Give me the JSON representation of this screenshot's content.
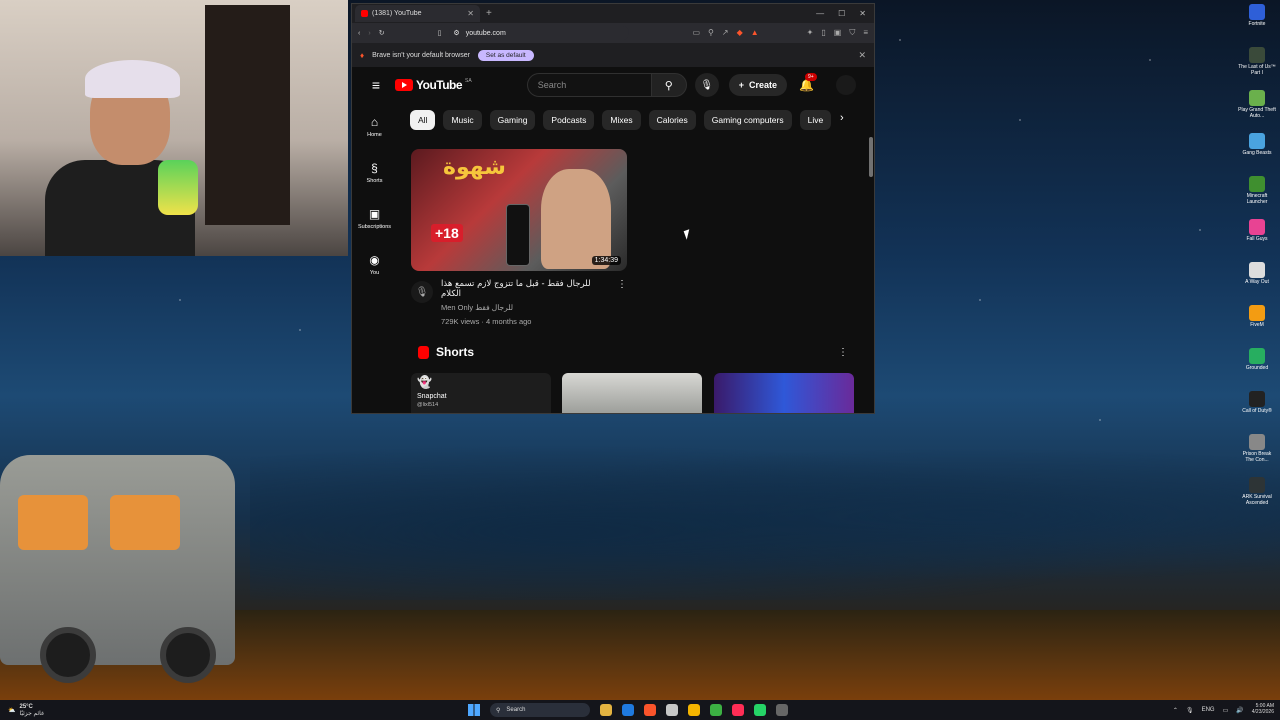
{
  "browser": {
    "tab_title": "(1381) YouTube",
    "url": "youtube.com",
    "infobar_text": "Brave isn't your default browser",
    "set_default_label": "Set as default"
  },
  "youtube": {
    "logo_text": "YouTube",
    "region": "SA",
    "search_placeholder": "Search",
    "create_label": "Create",
    "notification_count": "9+",
    "sidebar": [
      {
        "label": "Home",
        "icon": "home-icon"
      },
      {
        "label": "Shorts",
        "icon": "shorts-icon"
      },
      {
        "label": "Subscriptions",
        "icon": "subscriptions-icon"
      },
      {
        "label": "You",
        "icon": "you-icon"
      }
    ],
    "chips": [
      "All",
      "Music",
      "Gaming",
      "Podcasts",
      "Mixes",
      "Calories",
      "Gaming computers",
      "Live"
    ],
    "video": {
      "thumb_text": "شهوة",
      "thumb_tag": "+18",
      "duration": "1:34:39",
      "title": "للرجال فقط - قبل ما تتزوج لازم تسمع هذا الكلام",
      "channel": "Men Only للرجال فقط",
      "stats": "729K views · 4 months ago"
    },
    "shorts_heading": "Shorts",
    "short1": {
      "name": "Snapchat",
      "handle": "@lixl514"
    }
  },
  "desktop_icons": [
    {
      "label": "Fortnite",
      "color": "#2e5fd8"
    },
    {
      "label": "The Last of Us™ Part I",
      "color": "#3a4a3a"
    },
    {
      "label": "Play Grand Theft Auto...",
      "color": "#6ab04c"
    },
    {
      "label": "Gang Beasts",
      "color": "#4aa3df"
    },
    {
      "label": "Minecraft Launcher",
      "color": "#3f8f2f"
    },
    {
      "label": "Fall Guys",
      "color": "#e84393"
    },
    {
      "label": "A Way Out",
      "color": "#dddddd"
    },
    {
      "label": "FiveM",
      "color": "#f39c12"
    },
    {
      "label": "Grounded",
      "color": "#27ae60"
    },
    {
      "label": "Call of Duty®",
      "color": "#222222"
    },
    {
      "label": "Prison Break The Con...",
      "color": "#888888"
    },
    {
      "label": "ARK Survival Ascended",
      "color": "#2d3436"
    }
  ],
  "taskbar": {
    "temperature": "25°C",
    "weather_desc": "غائم جزئيًا",
    "search_label": "Search",
    "language": "ENG",
    "time": "5:00 AM",
    "date": "4/23/2026"
  }
}
